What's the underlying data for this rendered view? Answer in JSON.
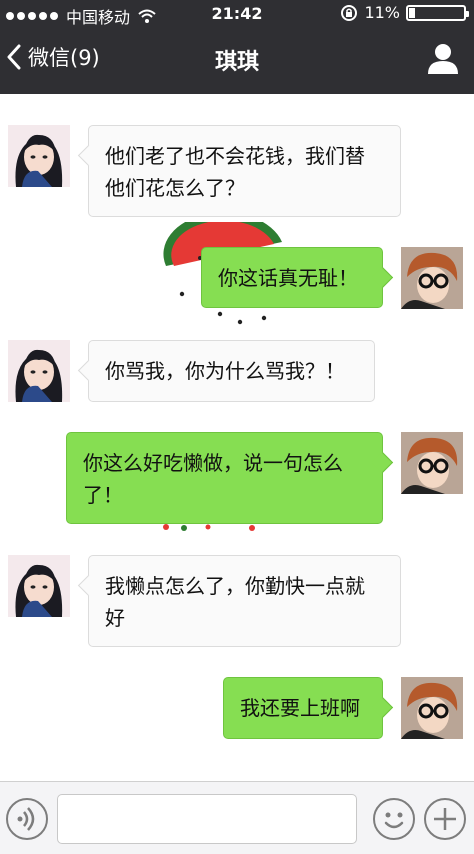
{
  "status_bar": {
    "carrier": "中国移动",
    "time": "21:42",
    "battery": "11%",
    "battery_level": 0.11
  },
  "nav": {
    "back_label": "微信(9)",
    "title": "琪琪"
  },
  "messages": [
    {
      "side": "left",
      "lines": [
        "他们老了也不会花钱，我们替",
        "他们花怎么了？"
      ]
    },
    {
      "side": "right",
      "lines": [
        "你这话真无耻！"
      ]
    },
    {
      "side": "left",
      "lines": [
        "你骂我，你为什么骂我？！"
      ]
    },
    {
      "side": "right",
      "lines": [
        "你这么好吃懒做，说一句怎么",
        "了！"
      ]
    },
    {
      "side": "left",
      "lines": [
        "我懒点怎么了，你勤快一点就",
        "好"
      ]
    },
    {
      "side": "right",
      "lines": [
        "我还要上班啊"
      ]
    }
  ],
  "input": {
    "value": "",
    "placeholder": ""
  },
  "icons": {
    "voice": "voice-icon",
    "emoji": "emoji-icon",
    "plus": "plus-icon",
    "profile": "person-icon",
    "back": "chevron-left-icon"
  },
  "colors": {
    "bar_bg": "#2f2f33",
    "sent_bubble": "#86de52",
    "received_bubble": "#fafafa"
  }
}
